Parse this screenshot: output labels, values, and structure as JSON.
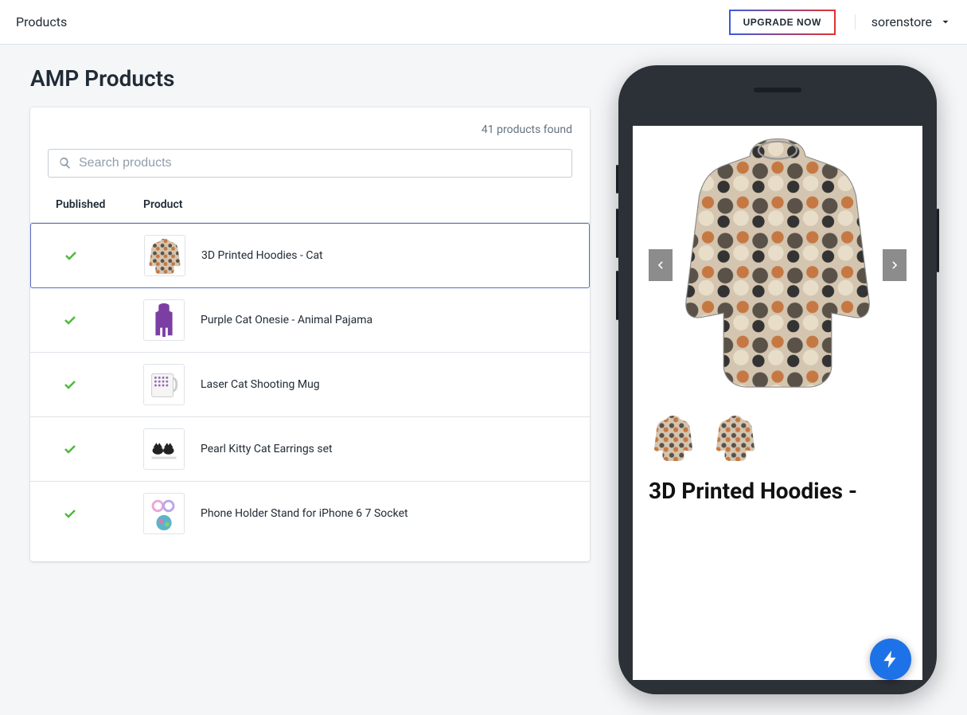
{
  "header": {
    "title": "Products",
    "upgrade_label": "UPGRADE NOW",
    "store_name": "sorenstore"
  },
  "page_title": "AMP Products",
  "count_text": "41 products found",
  "search": {
    "placeholder": "Search products"
  },
  "table": {
    "columns": {
      "published": "Published",
      "product": "Product"
    },
    "rows": [
      {
        "published": true,
        "name": "3D Printed Hoodies - Cat",
        "selected": true,
        "thumb": "sweater"
      },
      {
        "published": true,
        "name": "Purple Cat Onesie - Animal Pajama",
        "selected": false,
        "thumb": "onesie"
      },
      {
        "published": true,
        "name": "Laser Cat Shooting Mug",
        "selected": false,
        "thumb": "mug"
      },
      {
        "published": true,
        "name": "Pearl Kitty Cat Earrings set",
        "selected": false,
        "thumb": "earrings"
      },
      {
        "published": true,
        "name": "Phone Holder Stand for iPhone 6 7 Socket",
        "selected": false,
        "thumb": "popsocket"
      }
    ]
  },
  "preview": {
    "title": "3D Printed Hoodies -"
  }
}
